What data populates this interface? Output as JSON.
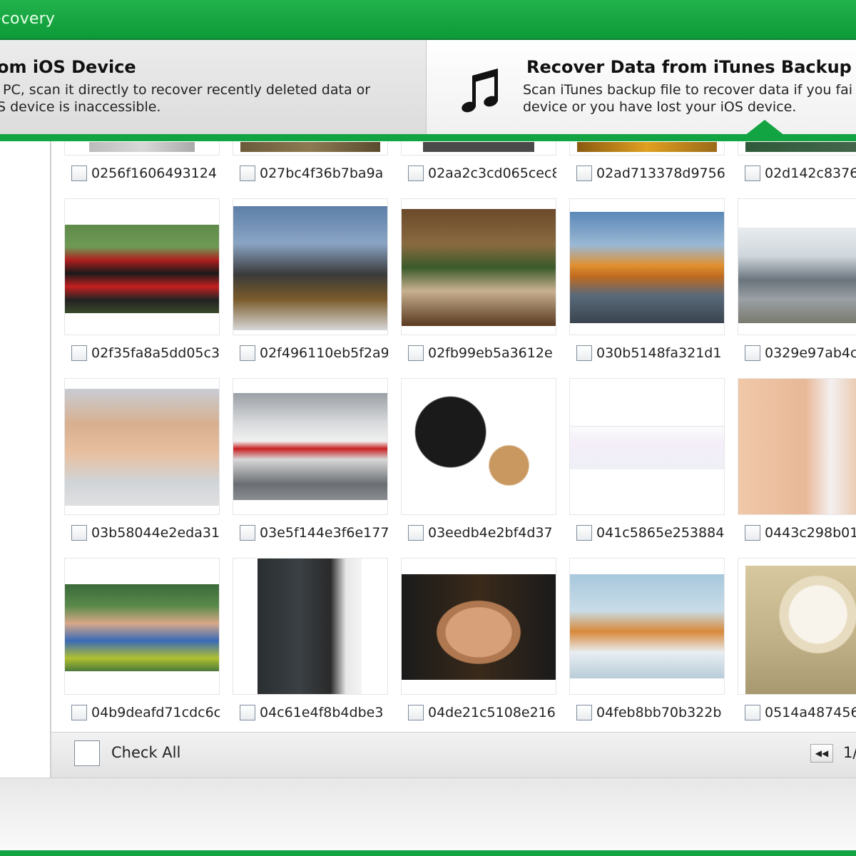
{
  "window": {
    "title": "ecovery"
  },
  "modes": {
    "ios_device": {
      "title": "om iOS Device",
      "desc_line1": "PC, scan it directly to recover recently deleted data or",
      "desc_line2": "S device is inaccessible."
    },
    "itunes_backup": {
      "title": "Recover Data from iTunes Backup Fi",
      "desc_line1": "Scan iTunes backup file to recover data if you fai",
      "desc_line2": "device or you have lost your iOS device.",
      "icon": "music-note-icon"
    }
  },
  "photos": {
    "row0": [
      "0256f1606493124",
      "027bc4f36b7ba9a",
      "02aa2c3cd065cec8",
      "02ad713378d9756",
      "02d142c8376"
    ],
    "row1": [
      "02f35fa8a5dd05c3",
      "02f496110eb5f2a9",
      "02fb99eb5a3612e",
      "030b5148fa321d1",
      "0329e97ab4c"
    ],
    "row2": [
      "03b58044e2eda31",
      "03e5f144e3f6e177",
      "03eedb4e2bf4d37",
      "041c5865e253884",
      "0443c298b01"
    ],
    "row3": [
      "04b9deafd71cdc6c",
      "04c61e4f8b4dbe3",
      "04de21c5108e216",
      "04feb8bb70b322b",
      "0514a487456"
    ]
  },
  "footer": {
    "check_all": "Check All",
    "page": "1/"
  },
  "colors": {
    "brand_green": "#12a443",
    "title_green": "#22b24c"
  }
}
